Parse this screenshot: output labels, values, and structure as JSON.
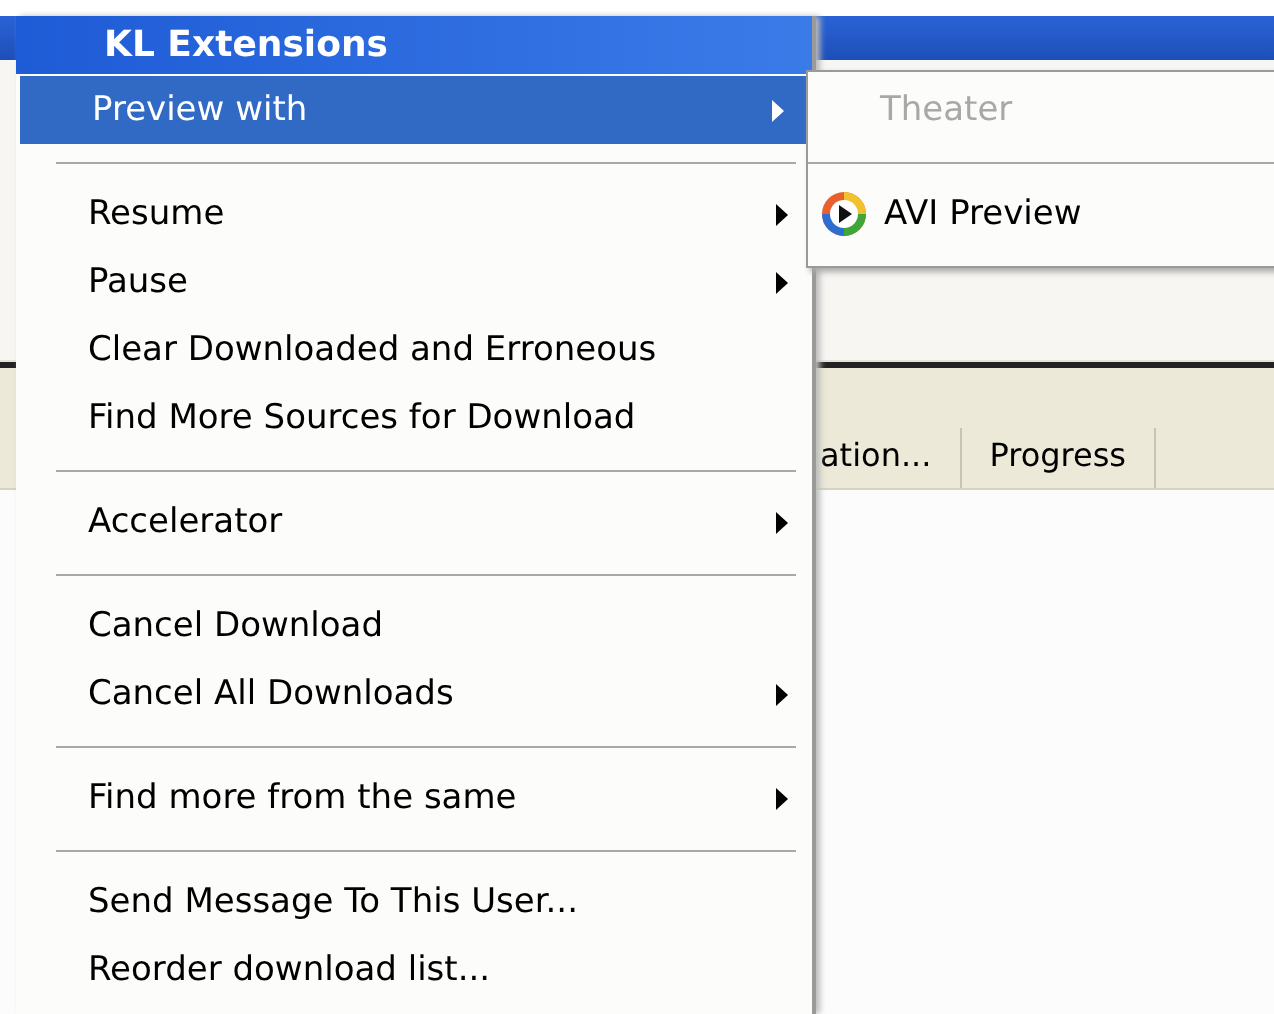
{
  "window": {
    "columns": [
      "ation...",
      "Progress"
    ]
  },
  "menu": {
    "title": "KL Extensions",
    "items": [
      {
        "kind": "item",
        "label": "Preview with",
        "arrow": true,
        "selected": true
      },
      {
        "kind": "separator"
      },
      {
        "kind": "item",
        "label": "Resume",
        "arrow": true,
        "selected": false
      },
      {
        "kind": "item",
        "label": "Pause",
        "arrow": true,
        "selected": false
      },
      {
        "kind": "item",
        "label": "Clear Downloaded and Erroneous",
        "arrow": false,
        "selected": false
      },
      {
        "kind": "item",
        "label": "Find More Sources for Download",
        "arrow": false,
        "selected": false
      },
      {
        "kind": "separator"
      },
      {
        "kind": "item",
        "label": "Accelerator",
        "arrow": true,
        "selected": false
      },
      {
        "kind": "separator"
      },
      {
        "kind": "item",
        "label": "Cancel Download",
        "arrow": false,
        "selected": false
      },
      {
        "kind": "item",
        "label": "Cancel All Downloads",
        "arrow": true,
        "selected": false
      },
      {
        "kind": "separator"
      },
      {
        "kind": "item",
        "label": "Find more from the same",
        "arrow": true,
        "selected": false
      },
      {
        "kind": "separator"
      },
      {
        "kind": "item",
        "label": "Send Message To This User...",
        "arrow": false,
        "selected": false
      },
      {
        "kind": "item",
        "label": "Reorder download list...",
        "arrow": false,
        "selected": false
      }
    ]
  },
  "submenu": {
    "items": [
      {
        "kind": "item",
        "label": "Theater",
        "disabled": true
      },
      {
        "kind": "separator"
      },
      {
        "kind": "icon-item",
        "label": "AVI Preview",
        "disabled": false
      }
    ]
  }
}
